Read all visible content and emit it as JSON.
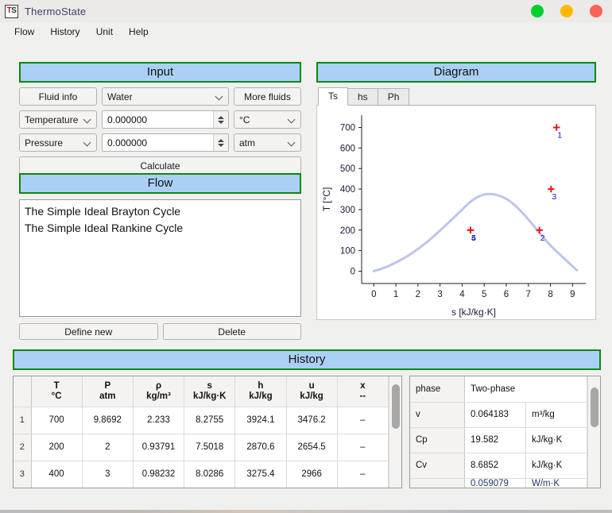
{
  "window": {
    "app_icon_text_1": "T",
    "app_icon_text_2": "S",
    "title": "ThermoState",
    "buttons": {
      "minimize": "minimize",
      "maximize": "maximize",
      "close": "close"
    },
    "colors": {
      "green": "#00ce2e",
      "amber": "#ffb900",
      "red": "#fa6455",
      "accent_header": "#abd0f5",
      "accent_border": "#0a8a0a"
    }
  },
  "menubar": {
    "items": [
      "Flow",
      "History",
      "Unit",
      "Help"
    ]
  },
  "input": {
    "title": "Input",
    "fluid_info_label": "Fluid info",
    "fluid_value": "Water",
    "more_fluids_label": "More fluids",
    "rows": [
      {
        "property": "Temperature",
        "value": "0.000000",
        "unit": "°C"
      },
      {
        "property": "Pressure",
        "value": "0.000000",
        "unit": "atm"
      }
    ],
    "calculate_label": "Calculate"
  },
  "flow": {
    "title": "Flow",
    "items": [
      "The Simple Ideal Brayton Cycle",
      "The Simple Ideal Rankine Cycle"
    ],
    "define_new_label": "Define new",
    "delete_label": "Delete"
  },
  "diagram": {
    "title": "Diagram",
    "tabs": [
      {
        "label": "Ts",
        "active": true
      },
      {
        "label": "hs",
        "active": false
      },
      {
        "label": "Ph",
        "active": false
      }
    ]
  },
  "chart_data": {
    "type": "scatter",
    "title": "",
    "xlabel": "s [kJ/kg·K]",
    "ylabel": "T [°C]",
    "xlim": [
      -0.55,
      9.6
    ],
    "ylim": [
      -60,
      760
    ],
    "xticks": [
      0,
      1,
      2,
      3,
      4,
      5,
      6,
      7,
      8,
      9
    ],
    "yticks": [
      0,
      100,
      200,
      300,
      400,
      500,
      600,
      700
    ],
    "grid": false,
    "legend": false,
    "series": [
      {
        "name": "saturation dome",
        "type": "line",
        "color": "#bfc4ec",
        "x": [
          0.0,
          0.5,
          1.0,
          1.5,
          2.0,
          2.5,
          3.0,
          3.5,
          4.0,
          4.4,
          4.8,
          5.2,
          5.6,
          6.0,
          6.4,
          6.8,
          7.2,
          7.6,
          8.0,
          8.4,
          8.8,
          9.2
        ],
        "y": [
          0,
          18,
          42,
          72,
          108,
          150,
          198,
          248,
          300,
          340,
          366,
          376,
          370,
          352,
          320,
          276,
          226,
          174,
          126,
          84,
          44,
          4
        ]
      },
      {
        "name": "state points",
        "type": "scatter",
        "color": "#ee1111",
        "label_color": "#1111cc",
        "points": [
          {
            "label": "1",
            "x": 8.2755,
            "y": 700
          },
          {
            "label": "2",
            "x": 7.5018,
            "y": 200
          },
          {
            "label": "3",
            "x": 8.0286,
            "y": 400
          },
          {
            "label": "4",
            "x": 4.38,
            "y": 200
          },
          {
            "label": "5",
            "x": 4.38,
            "y": 200
          }
        ]
      }
    ]
  },
  "history": {
    "title": "History",
    "columns": [
      {
        "name": "T",
        "unit": "°C"
      },
      {
        "name": "P",
        "unit": "atm"
      },
      {
        "name": "ρ",
        "unit": "kg/m³"
      },
      {
        "name": "s",
        "unit": "kJ/kg·K"
      },
      {
        "name": "h",
        "unit": "kJ/kg"
      },
      {
        "name": "u",
        "unit": "kJ/kg"
      },
      {
        "name": "x",
        "unit": "--"
      }
    ],
    "rows": [
      {
        "n": "1",
        "cells": [
          "700",
          "9.8692",
          "2.233",
          "8.2755",
          "3924.1",
          "3476.2",
          "–"
        ]
      },
      {
        "n": "2",
        "cells": [
          "200",
          "2",
          "0.93791",
          "7.5018",
          "2870.6",
          "2654.5",
          "–"
        ]
      },
      {
        "n": "3",
        "cells": [
          "400",
          "3",
          "0.98232",
          "8.0286",
          "3275.4",
          "2966",
          "–"
        ]
      }
    ]
  },
  "properties": {
    "rows": [
      {
        "name": "phase",
        "value": "Two-phase",
        "unit": ""
      },
      {
        "name": "v",
        "value": "0.064183",
        "unit": "m³/kg"
      },
      {
        "name": "Cp",
        "value": "19.582",
        "unit": "kJ/kg·K"
      },
      {
        "name": "Cv",
        "value": "8.6852",
        "unit": "kJ/kg·K"
      },
      {
        "name": "",
        "value": "0.059079",
        "unit": "W/m·K"
      }
    ]
  }
}
